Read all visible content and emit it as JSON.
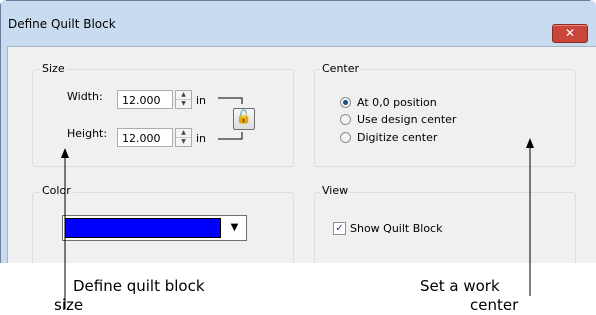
{
  "dialog": {
    "title": "Define Quilt Block",
    "close_glyph": "✕"
  },
  "size_group": {
    "label": "Size",
    "width_label": "Width:",
    "width_value": "12.000",
    "height_label": "Height:",
    "height_value": "12.000",
    "unit": "in",
    "lock_icon": "lock-icon",
    "lock_glyph": "🔓"
  },
  "center_group": {
    "label": "Center",
    "options": [
      "At 0,0 position",
      "Use design center",
      "Digitize center"
    ],
    "selected": 0
  },
  "color_group": {
    "label": "Color",
    "selected_color": "#0000ff",
    "drop_glyph": "▼"
  },
  "view_group": {
    "label": "View",
    "show_quilt_block_label": "Show Quilt Block",
    "show_quilt_block_checked": true,
    "check_glyph": "✓"
  },
  "callouts": {
    "left_line1": "Define quilt block",
    "left_line2": "size",
    "right_line1": "Set a work",
    "right_line2": "center"
  }
}
